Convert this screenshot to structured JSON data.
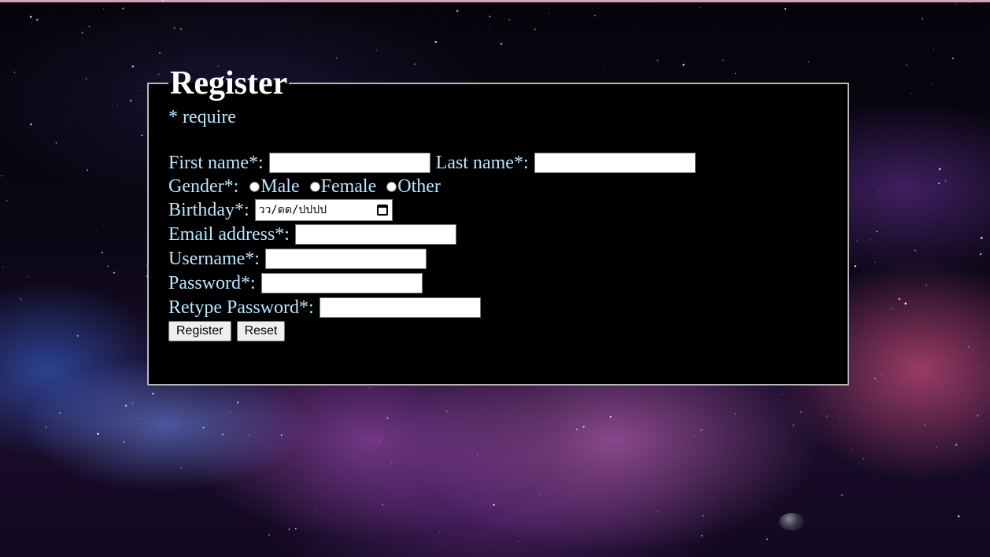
{
  "form": {
    "title": "Register",
    "require_note": "* require",
    "first_name_label": "First name*:",
    "last_name_label": "Last name*:",
    "gender_label": "Gender*:",
    "gender_options": [
      "Male",
      "Female",
      "Other"
    ],
    "birthday_label": "Birthday*:",
    "birthday_placeholder": "วว/ดด/ปปปป",
    "email_label": "Email address*:",
    "username_label": "Username*:",
    "password_label": "Password*:",
    "retype_password_label": "Retype Password*:",
    "register_button": "Register",
    "reset_button": "Reset"
  },
  "colors": {
    "label_text": "#b8e8ff",
    "title_text": "#ffffff",
    "panel_background": "#000000",
    "panel_border": "#b9b9b9"
  }
}
